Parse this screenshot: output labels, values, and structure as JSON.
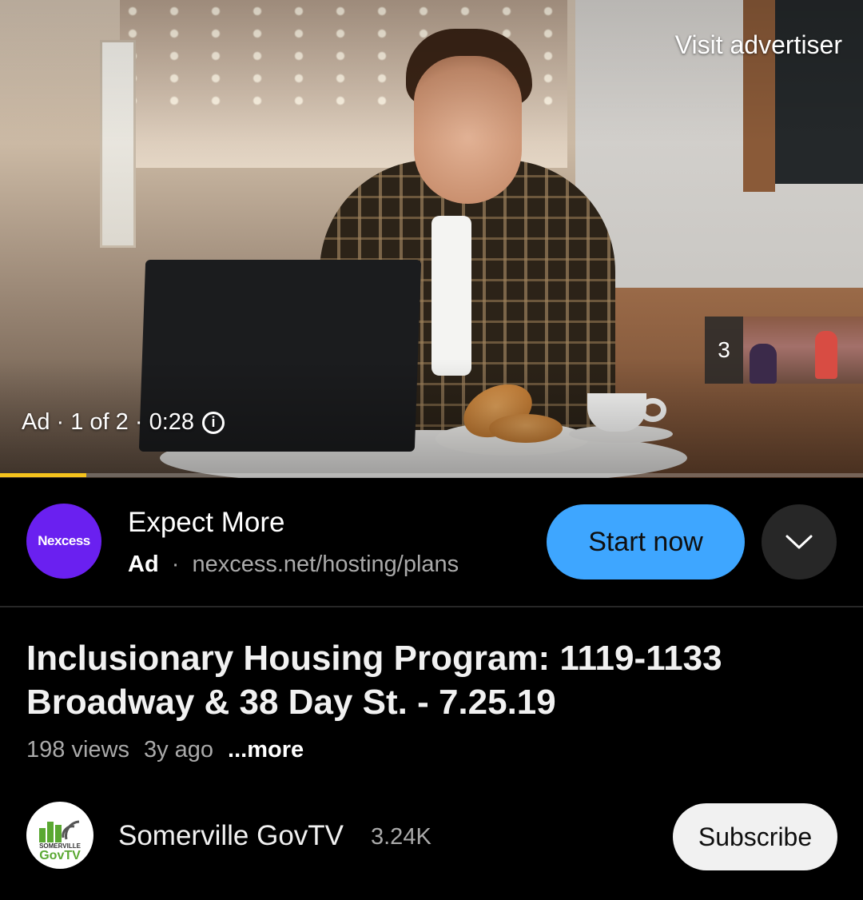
{
  "player": {
    "visit_advertiser": "Visit advertiser",
    "ad_status": "Ad · 1 of 2 · 0:28",
    "info_icon": "info-icon",
    "up_next_count": "3",
    "progress": 0.1
  },
  "ad": {
    "logo_text": "Nexcess",
    "title": "Expect More",
    "badge": "Ad",
    "separator": "·",
    "url": "nexcess.net/hosting/plans",
    "cta_label": "Start now",
    "expand_icon": "chevron-down-icon"
  },
  "video": {
    "title": "Inclusionary Housing Program: 1119-1133 Broadway & 38 Day St. - 7.25.19",
    "views": "198 views",
    "age": "3y ago",
    "more_label": "...more"
  },
  "channel": {
    "avatar_top": "SOMERVILLE",
    "avatar_bottom": "GovTV",
    "name": "Somerville GovTV",
    "subscriber_count": "3.24K",
    "subscribe_label": "Subscribe"
  },
  "colors": {
    "background": "#000000",
    "cta_blue": "#3ea6ff",
    "ad_logo": "#6a20f0",
    "progress": "#f5c31d"
  }
}
